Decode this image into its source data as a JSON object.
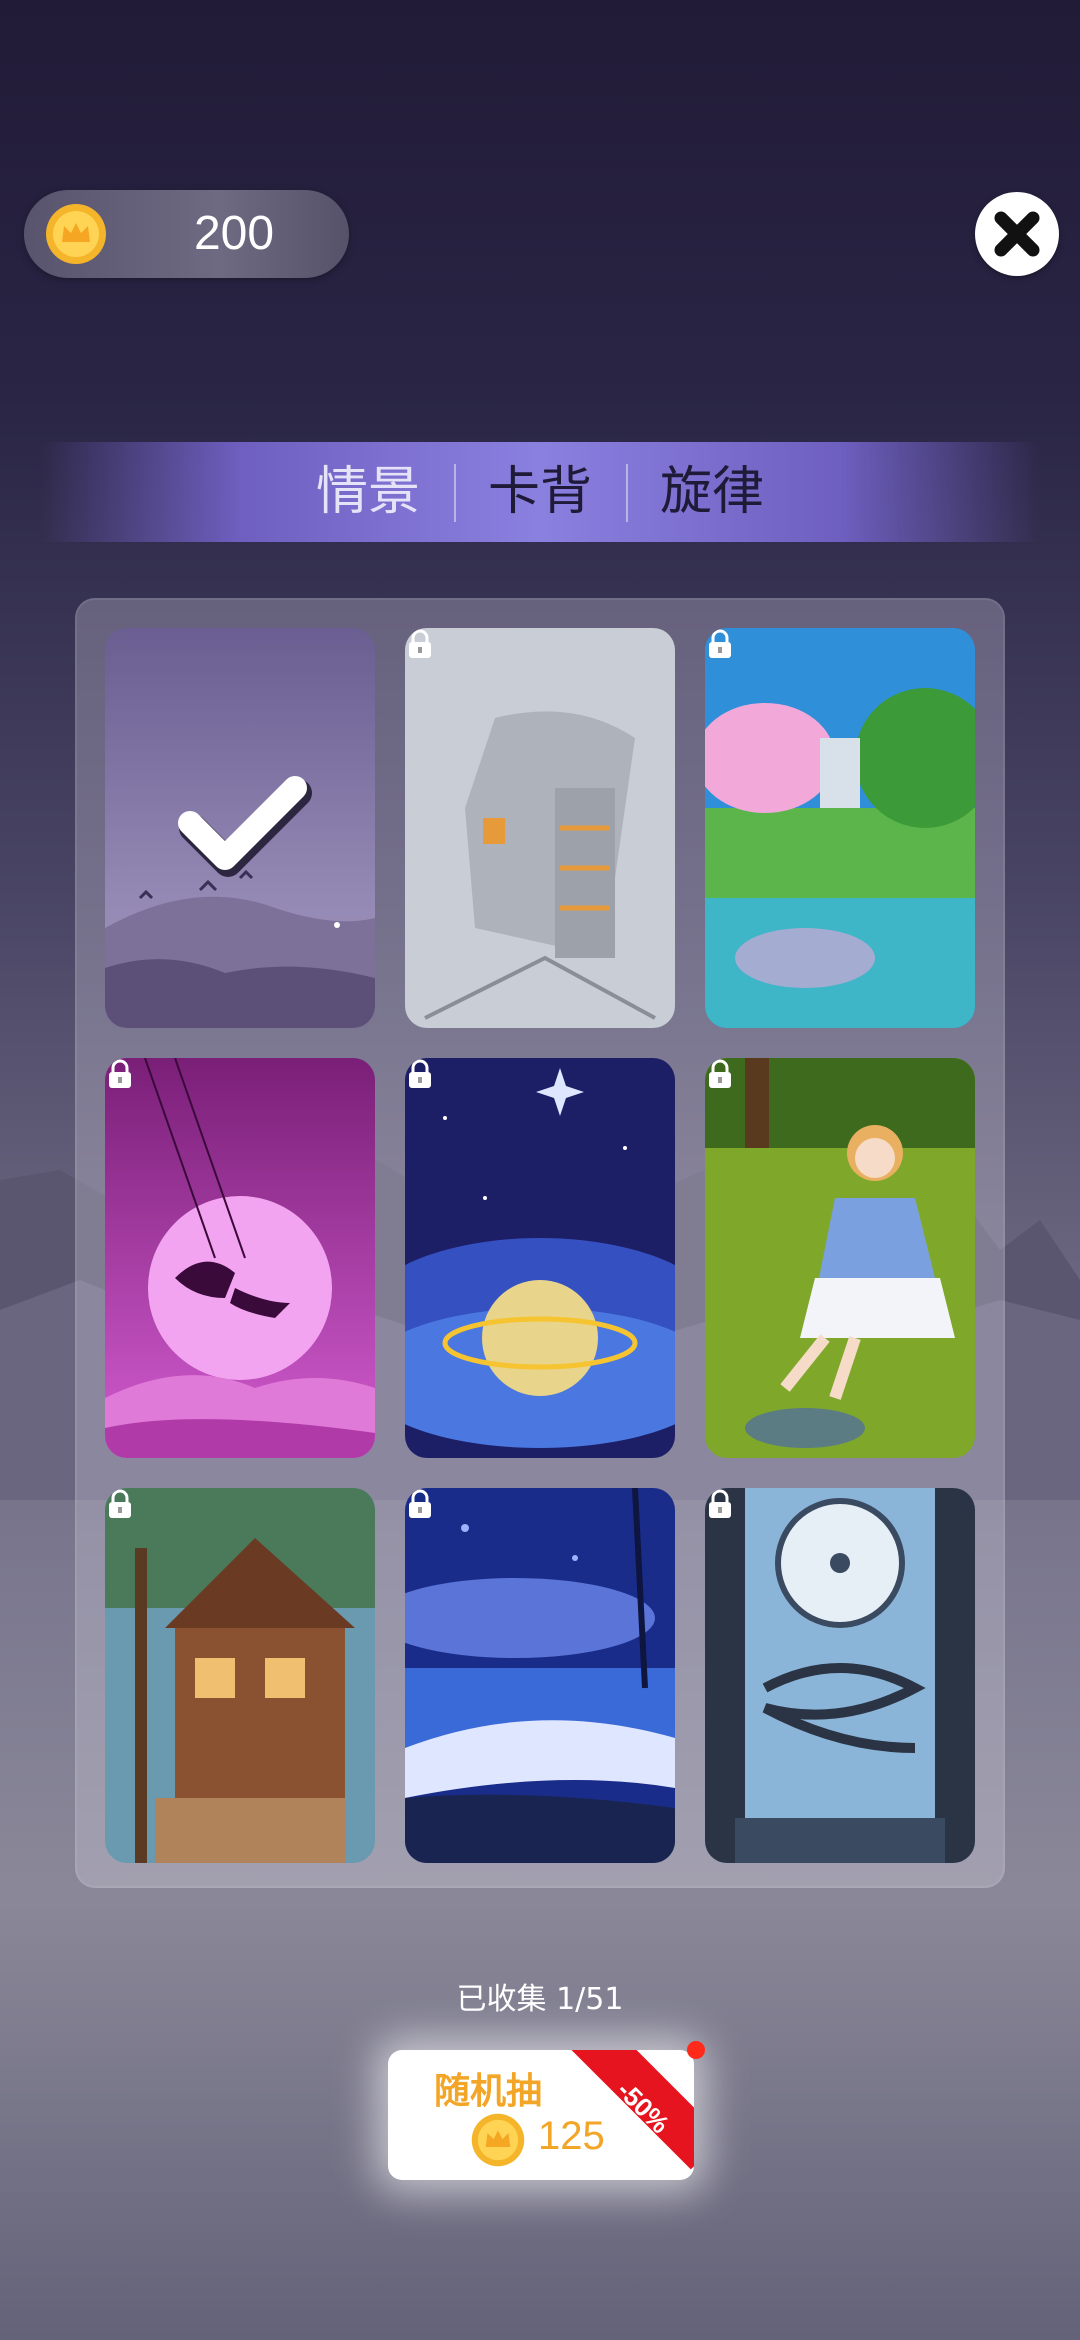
{
  "header": {
    "coin_balance": "200",
    "coin_icon": "crown-coin-icon",
    "close_icon": "close-icon"
  },
  "tabs": [
    {
      "label": "情景",
      "active": true
    },
    {
      "label": "卡背",
      "active": false
    },
    {
      "label": "旋律",
      "active": false
    }
  ],
  "cards": [
    {
      "theme": "purple-hills-birds",
      "selected": true,
      "locked": false
    },
    {
      "theme": "grey-sketch-house",
      "selected": false,
      "locked": true
    },
    {
      "theme": "cherry-blossom-garden",
      "selected": false,
      "locked": true
    },
    {
      "theme": "pink-moon-swing",
      "selected": false,
      "locked": true
    },
    {
      "theme": "blue-planet-space",
      "selected": false,
      "locked": true
    },
    {
      "theme": "anime-girl-meadow",
      "selected": false,
      "locked": true
    },
    {
      "theme": "forest-treehouse",
      "selected": false,
      "locked": true
    },
    {
      "theme": "night-beach",
      "selected": false,
      "locked": true
    },
    {
      "theme": "spiral-staircase-clock",
      "selected": false,
      "locked": true
    }
  ],
  "footer": {
    "collected_text": "已收集 1/51",
    "draw_button_label": "随机抽",
    "draw_price": "125",
    "discount_badge": "-50%"
  },
  "colors": {
    "accent_gold": "#f2a526",
    "tab_active": "#e6e2f8",
    "tab_inactive": "#1e1a38",
    "discount_red": "#e5141e"
  }
}
